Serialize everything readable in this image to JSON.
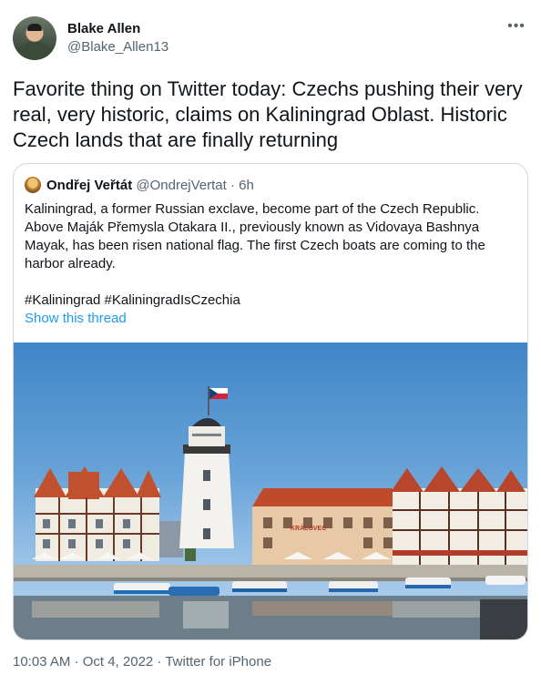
{
  "author": {
    "display_name": "Blake Allen",
    "handle": "@Blake_Allen13"
  },
  "more_icon": "more-horizontal-icon",
  "tweet_text": "Favorite thing on Twitter today: Czechs pushing their very real, very historic, claims on Kaliningrad Oblast. Historic Czech lands that are finally returning",
  "quote": {
    "display_name": "Ondřej Veřtát",
    "handle": "@OndrejVertat",
    "separator": " · ",
    "time": "6h",
    "body_paragraph_1": "Kaliningrad, a former Russian exclave, become part of the Czech Republic. Above Maják Přemysla Otakara II., previously known as Vidovaya Bashnya Mayak, has been risen national flag. The first Czech boats are coming to the harbor already.",
    "body_paragraph_2": "#Kaliningrad #KaliningradIsCzechia",
    "show_thread": "Show this thread",
    "photo_sign": "KRÁLOVEC"
  },
  "footer": {
    "text": "10:03 AM · Oct 4, 2022 · Twitter for iPhone"
  },
  "colors": {
    "link": "#1d9bf0",
    "secondary_text": "#536471",
    "border": "#cfd9de"
  }
}
